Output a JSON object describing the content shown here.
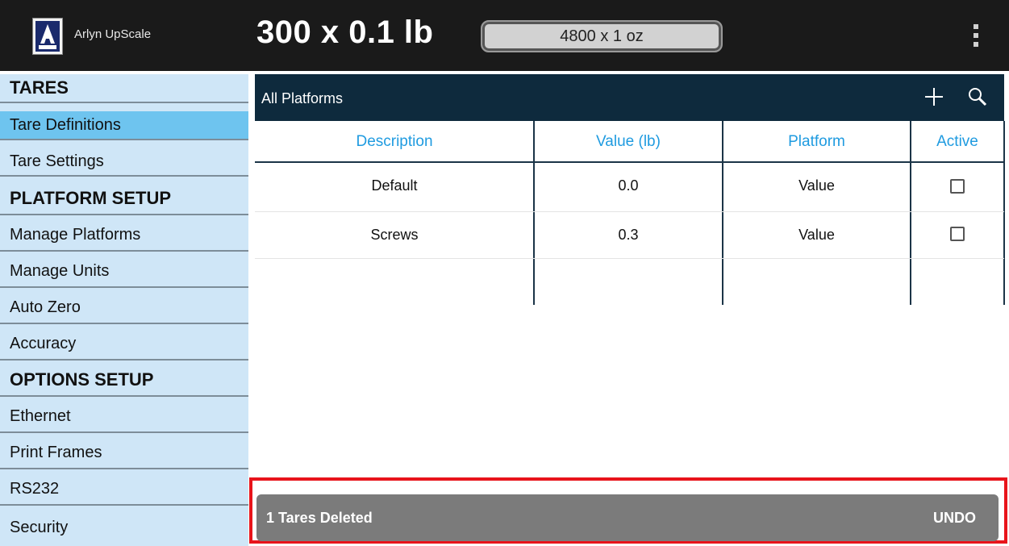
{
  "header": {
    "app_title": "Arlyn UpScale",
    "primary_reading": "300 x 0.1 lb",
    "secondary_reading": "4800 x 1 oz"
  },
  "sidebar": {
    "items": [
      {
        "label": "TARES",
        "type": "header"
      },
      {
        "label": "Tare Definitions",
        "type": "item",
        "selected": true
      },
      {
        "label": "Tare Settings",
        "type": "item"
      },
      {
        "label": "PLATFORM SETUP",
        "type": "header"
      },
      {
        "label": "Manage Platforms",
        "type": "item"
      },
      {
        "label": "Manage Units",
        "type": "item"
      },
      {
        "label": "Auto Zero",
        "type": "item"
      },
      {
        "label": "Accuracy",
        "type": "item"
      },
      {
        "label": "OPTIONS SETUP",
        "type": "header"
      },
      {
        "label": "Ethernet",
        "type": "item"
      },
      {
        "label": "Print Frames",
        "type": "item"
      },
      {
        "label": "RS232",
        "type": "item"
      },
      {
        "label": "Security",
        "type": "item"
      }
    ]
  },
  "panel": {
    "title": "All Platforms",
    "add_icon": "plus-icon",
    "search_icon": "search-icon"
  },
  "table": {
    "columns": [
      "Description",
      "Value (lb)",
      "Platform",
      "Active"
    ],
    "rows": [
      {
        "description": "Default",
        "value": "0.0",
        "platform": "Value",
        "active": false
      },
      {
        "description": "Screws",
        "value": "0.3",
        "platform": "Value",
        "active": false
      }
    ]
  },
  "snackbar": {
    "message": "1 Tares Deleted",
    "action": "UNDO"
  },
  "colors": {
    "topbar": "#1a1a1a",
    "sidebar": "#cfe6f7",
    "sidebar_selected": "#6ec4ef",
    "panel_header": "#0e2a3d",
    "column_header_text": "#1f9be0",
    "snackbar": "#7b7b7b",
    "highlight_outline": "#e8141b"
  }
}
